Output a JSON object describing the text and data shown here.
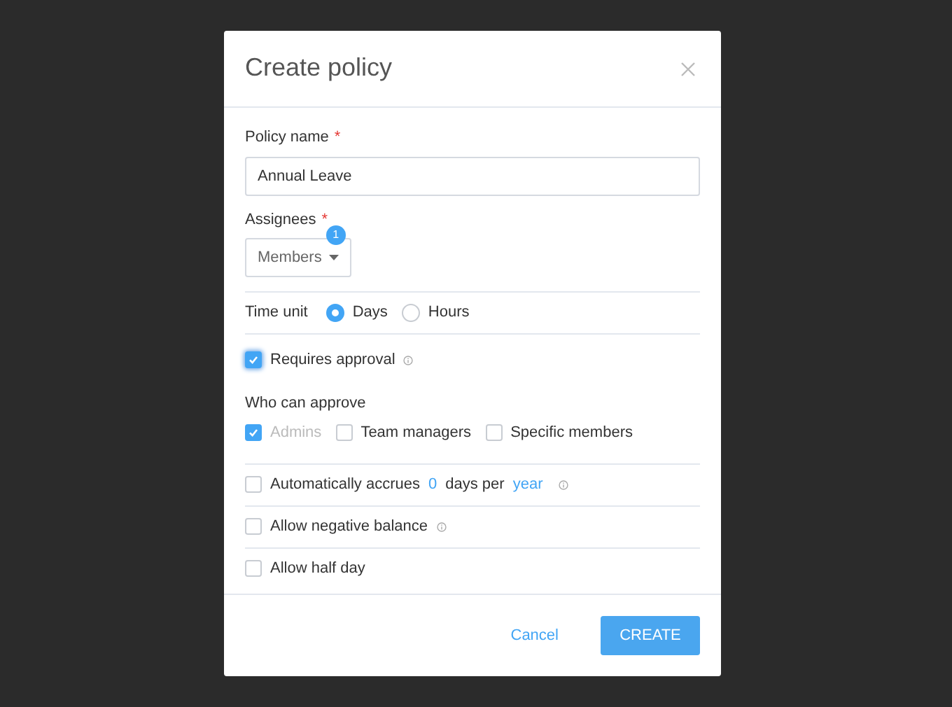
{
  "dialog": {
    "title": "Create policy"
  },
  "policy_name": {
    "label": "Policy name",
    "required_mark": "*",
    "value": "Annual Leave"
  },
  "assignees": {
    "label": "Assignees",
    "required_mark": "*",
    "value": "Members",
    "badge": "1"
  },
  "time_unit": {
    "label": "Time unit",
    "options": [
      {
        "label": "Days",
        "selected": true
      },
      {
        "label": "Hours",
        "selected": false
      }
    ]
  },
  "requires_approval": {
    "label": "Requires approval",
    "checked": true
  },
  "who_can_approve": {
    "label": "Who can approve",
    "options": [
      {
        "label": "Admins",
        "checked": true,
        "disabled": true
      },
      {
        "label": "Team managers",
        "checked": false,
        "disabled": false
      },
      {
        "label": "Specific members",
        "checked": false,
        "disabled": false
      }
    ]
  },
  "options": [
    {
      "kind": "accrual",
      "checked": false,
      "label": "Automatically accrues",
      "amount": "0",
      "unit": "days per",
      "period": "year",
      "info": true
    },
    {
      "kind": "plain",
      "checked": false,
      "label": "Allow negative balance",
      "info": true
    },
    {
      "kind": "plain",
      "checked": false,
      "label": "Allow half day"
    }
  ],
  "footer": {
    "cancel": "Cancel",
    "create": "CREATE"
  }
}
